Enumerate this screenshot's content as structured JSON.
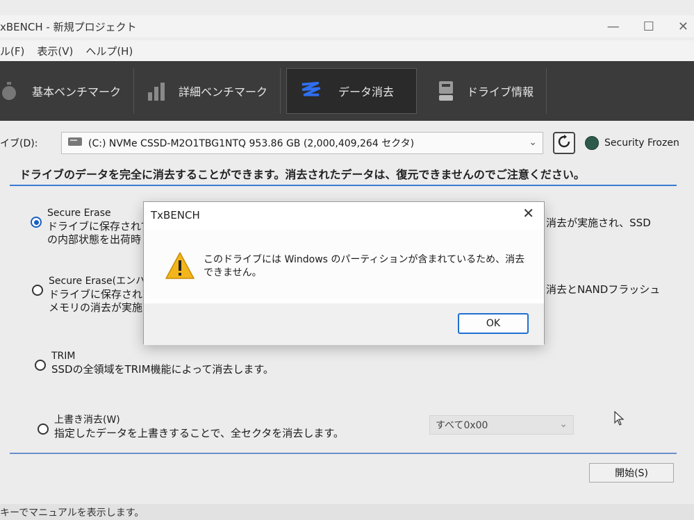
{
  "window": {
    "title": "xBENCH - 新規プロジェクト",
    "controls": [
      "—",
      "☐",
      "✕"
    ]
  },
  "menu": [
    "ル(F)",
    "表示(V)",
    "ヘルプ(H)"
  ],
  "toolbar": {
    "tabs": [
      {
        "label": "基本ベンチマーク",
        "icon": "stopwatch-icon"
      },
      {
        "label": "詳細ベンチマーク",
        "icon": "bar-chart-icon"
      },
      {
        "label": "データ消去",
        "icon": "erase-icon",
        "active": true
      },
      {
        "label": "ドライブ情報",
        "icon": "drive-info-icon"
      }
    ]
  },
  "drive": {
    "label": "イブ(D):",
    "selected": "(C:) NVMe CSSD-M2O1TBG1NTQ  953.86 GB (2,000,409,264 セクタ)",
    "security_status": "Security Frozen"
  },
  "notice": "ドライブのデータを完全に消去することができます。消去されたデータは、復元できませんのでご注意ください。",
  "options": [
    {
      "name": "Secure Erase",
      "lines": [
        "ドライブに保存されて",
        "の内部状態を出荷時"
      ],
      "right_text": "消去が実施され、SSD",
      "checked": true
    },
    {
      "name": "Secure Erase(エンハ",
      "lines": [
        "ドライブに保存されて",
        "メモリの消去が実施さ"
      ],
      "right_text": "消去とNANDフラッシュ",
      "checked": false
    },
    {
      "name": "TRIM",
      "lines": [
        "SSDの全領域をTRIM機能によって消去します。"
      ],
      "checked": false
    },
    {
      "name": "上書き消去(W)",
      "lines": [
        "指定したデータを上書きすることで、全セクタを消去します。"
      ],
      "checked": false
    }
  ],
  "overwrite_pattern": "すべて0x00",
  "start_button": "開始(S)",
  "status_bar": "キーでマニュアルを表示します。",
  "dialog": {
    "title": "TxBENCH",
    "message": "このドライブには Windows のパーティションが含まれているため、消去できません。",
    "ok_label": "OK"
  },
  "colors": {
    "toolbar_bg": "#3b3b3b",
    "accent_blue": "#1f6fd1",
    "security_dot": "#2e5a4c",
    "warning_yellow": "#f2b51b"
  }
}
